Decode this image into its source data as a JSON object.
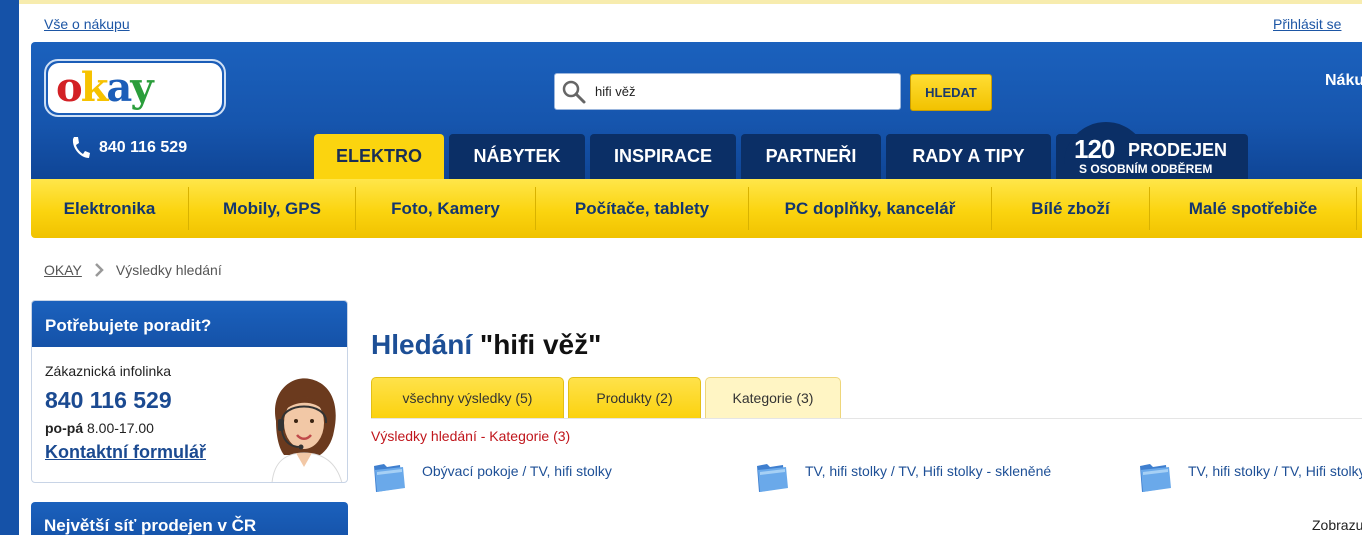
{
  "topbar": {
    "about": "Vše o nákupu",
    "login": "Přihlásit se"
  },
  "header": {
    "logo_text": "okay",
    "phone": "840 116 529",
    "search": {
      "value": "hifi věž",
      "button": "HLEDAT"
    },
    "cart_label": "Náku",
    "tabs": [
      "ELEKTRO",
      "NÁBYTEK",
      "INSPIRACE",
      "PARTNEŘI",
      "RADY A TIPY"
    ],
    "active_tab": "ELEKTRO",
    "promo": {
      "number": "120",
      "big": "PRODEJEN",
      "small": "S OSOBNÍM ODBĚREM"
    }
  },
  "categories": [
    "Elektronika",
    "Mobily, GPS",
    "Foto, Kamery",
    "Počítače, tablety",
    "PC doplňky, kancelář",
    "Bílé zboží",
    "Malé spotřebiče"
  ],
  "breadcrumb": {
    "home": "OKAY",
    "current": "Výsledky hledání"
  },
  "help": {
    "title": "Potřebujete poradit?",
    "subtitle": "Zákaznická infolinka",
    "phone": "840 116 529",
    "hours_days": "po-pá",
    "hours_time": "8.00-17.00",
    "contact_link": "Kontaktní formulář"
  },
  "stores_title": "Největší síť prodejen v ČR",
  "results": {
    "heading_prefix": "Hledání",
    "heading_query": "\"hifi věž\"",
    "tabs": [
      "všechny výsledky (5)",
      "Produkty (2)",
      "Kategorie (3)"
    ],
    "active_tab": "Kategorie (3)",
    "subtitle": "Výsledky hledání - Kategorie (3)",
    "items": [
      "Obývací pokoje / TV, hifi stolky",
      "TV, hifi stolky / TV, Hifi stolky - skleněné",
      "TV, hifi stolky / TV, Hifi stolky"
    ],
    "show_label": "Zobrazu"
  },
  "colors": {
    "brand_blue": "#1655ad",
    "brand_yellow": "#fbd40f",
    "dark_tab": "#0b2f66",
    "link_blue": "#1d4f96",
    "red": "#c0161c"
  }
}
